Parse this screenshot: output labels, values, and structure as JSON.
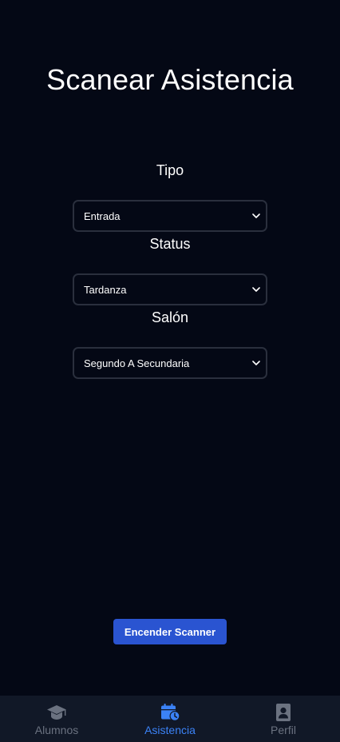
{
  "page": {
    "title": "Scanear Asistencia"
  },
  "form": {
    "tipo": {
      "label": "Tipo",
      "value": "Entrada"
    },
    "status": {
      "label": "Status",
      "value": "Tardanza"
    },
    "salon": {
      "label": "Salón",
      "value": "Segundo A Secundaria"
    }
  },
  "actions": {
    "scan_label": "Encender Scanner"
  },
  "nav": {
    "items": [
      {
        "label": "Alumnos",
        "icon": "graduation-cap-icon"
      },
      {
        "label": "Asistencia",
        "icon": "calendar-clock-icon",
        "active": true
      },
      {
        "label": "Perfil",
        "icon": "profile-badge-icon"
      }
    ]
  },
  "colors": {
    "background": "#040815",
    "nav_background": "#111827",
    "accent": "#3b82f6",
    "button": "#2a54d1",
    "muted": "#6b7280",
    "select_border": "#2a2f3d"
  }
}
